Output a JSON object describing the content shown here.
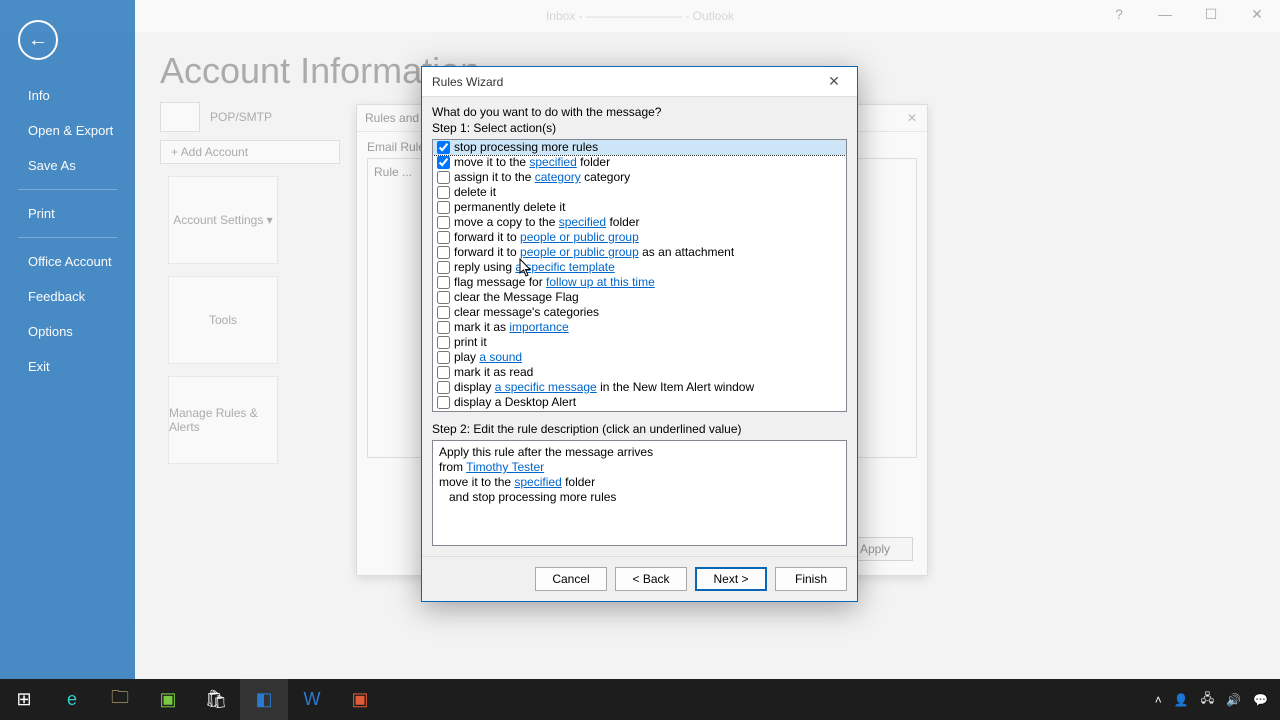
{
  "window": {
    "title": "Inbox - ———————— - Outlook"
  },
  "backstage": {
    "items": [
      "Info",
      "Open & Export",
      "Save As",
      "Print",
      "Office Account",
      "Feedback",
      "Options",
      "Exit"
    ]
  },
  "behind": {
    "heading": "Account Information",
    "pop": "POP/SMTP",
    "addAccount": "+  Add Account",
    "tiles": [
      "Account Settings ▾",
      "Tools",
      "Manage Rules & Alerts"
    ],
    "panelTitle": "Email Rules",
    "apply": "Apply"
  },
  "modal": {
    "title": "Rules Wizard",
    "question": "What do you want to do with the message?",
    "step1": "Step 1: Select action(s)",
    "actions": [
      {
        "checked": true,
        "selected": true,
        "segments": [
          {
            "t": "stop processing more rules"
          }
        ]
      },
      {
        "checked": true,
        "segments": [
          {
            "t": "move it to the "
          },
          {
            "t": "specified",
            "link": true
          },
          {
            "t": " folder"
          }
        ]
      },
      {
        "checked": false,
        "segments": [
          {
            "t": "assign it to the "
          },
          {
            "t": "category",
            "link": true
          },
          {
            "t": " category"
          }
        ]
      },
      {
        "checked": false,
        "segments": [
          {
            "t": "delete it"
          }
        ]
      },
      {
        "checked": false,
        "segments": [
          {
            "t": "permanently delete it"
          }
        ]
      },
      {
        "checked": false,
        "segments": [
          {
            "t": "move a copy to the "
          },
          {
            "t": "specified",
            "link": true
          },
          {
            "t": " folder"
          }
        ]
      },
      {
        "checked": false,
        "segments": [
          {
            "t": "forward it to "
          },
          {
            "t": "people or public group",
            "link": true
          }
        ]
      },
      {
        "checked": false,
        "segments": [
          {
            "t": "forward it to "
          },
          {
            "t": "people or public group",
            "link": true
          },
          {
            "t": " as an attachment"
          }
        ]
      },
      {
        "checked": false,
        "segments": [
          {
            "t": "reply using "
          },
          {
            "t": "a specific template",
            "link": true
          }
        ]
      },
      {
        "checked": false,
        "segments": [
          {
            "t": "flag message for "
          },
          {
            "t": "follow up at this time",
            "link": true
          }
        ]
      },
      {
        "checked": false,
        "segments": [
          {
            "t": "clear the Message Flag"
          }
        ]
      },
      {
        "checked": false,
        "segments": [
          {
            "t": "clear message's categories"
          }
        ]
      },
      {
        "checked": false,
        "segments": [
          {
            "t": "mark it as "
          },
          {
            "t": "importance",
            "link": true
          }
        ]
      },
      {
        "checked": false,
        "segments": [
          {
            "t": "print it"
          }
        ]
      },
      {
        "checked": false,
        "segments": [
          {
            "t": "play "
          },
          {
            "t": "a sound",
            "link": true
          }
        ]
      },
      {
        "checked": false,
        "segments": [
          {
            "t": "mark it as read"
          }
        ]
      },
      {
        "checked": false,
        "segments": [
          {
            "t": "display "
          },
          {
            "t": "a specific message",
            "link": true
          },
          {
            "t": " in the New Item Alert window"
          }
        ]
      },
      {
        "checked": false,
        "segments": [
          {
            "t": "display a Desktop Alert"
          }
        ]
      }
    ],
    "step2": "Step 2: Edit the rule description (click an underlined value)",
    "desc": {
      "line1": "Apply this rule after the message arrives",
      "line2a": "from ",
      "line2b": "Timothy Tester",
      "line3a": "move it to the ",
      "line3b": "specified",
      "line3c": " folder",
      "line4": "   and stop processing more rules"
    },
    "buttons": {
      "cancel": "Cancel",
      "back": "<  Back",
      "next": "Next  >",
      "finish": "Finish"
    }
  },
  "taskbar": {
    "time": "",
    "icons": [
      "⊞",
      "e",
      "📁",
      "🟩",
      "🛍",
      "📧",
      "W",
      "▣"
    ]
  }
}
